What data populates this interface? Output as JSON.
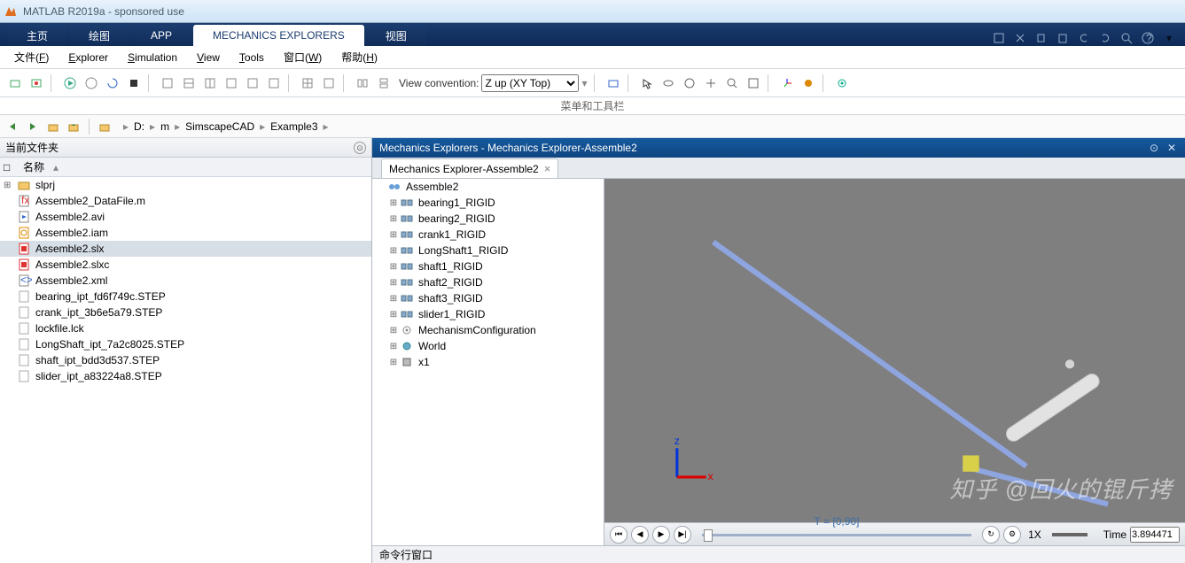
{
  "app": {
    "title": "MATLAB R2019a - sponsored use"
  },
  "ribbon_tabs": [
    {
      "label": "主页"
    },
    {
      "label": "绘图"
    },
    {
      "label": "APP"
    },
    {
      "label": "MECHANICS EXPLORERS",
      "active": true
    },
    {
      "label": "视图"
    }
  ],
  "menus": [
    {
      "label": "文件",
      "acc": "F"
    },
    {
      "label": "Explorer",
      "acc": "E"
    },
    {
      "label": "Simulation",
      "acc": "S"
    },
    {
      "label": "View",
      "acc": "V"
    },
    {
      "label": "Tools",
      "acc": "T"
    },
    {
      "label": "窗口",
      "acc": "W"
    },
    {
      "label": "帮助",
      "acc": "H"
    }
  ],
  "toolbar": {
    "view_convention_label": "View convention:",
    "view_convention_value": "Z up (XY Top)"
  },
  "hint": "菜单和工具栏",
  "breadcrumbs": [
    "D:",
    "m",
    "SimscapeCAD",
    "Example3",
    ""
  ],
  "current_folder": {
    "title": "当前文件夹",
    "col_name": "名称",
    "files": [
      {
        "name": "slprj",
        "icon": "folder",
        "expandable": true
      },
      {
        "name": "Assemble2_DataFile.m",
        "icon": "mfile"
      },
      {
        "name": "Assemble2.avi",
        "icon": "video"
      },
      {
        "name": "Assemble2.iam",
        "icon": "cad"
      },
      {
        "name": "Assemble2.slx",
        "icon": "simulink",
        "selected": true
      },
      {
        "name": "Assemble2.slxc",
        "icon": "simulink"
      },
      {
        "name": "Assemble2.xml",
        "icon": "xml"
      },
      {
        "name": "bearing_ipt_fd6f749c.STEP",
        "icon": "file"
      },
      {
        "name": "crank_ipt_3b6e5a79.STEP",
        "icon": "file"
      },
      {
        "name": "lockfile.lck",
        "icon": "file"
      },
      {
        "name": "LongShaft_ipt_7a2c8025.STEP",
        "icon": "file"
      },
      {
        "name": "shaft_ipt_bdd3d537.STEP",
        "icon": "file"
      },
      {
        "name": "slider_ipt_a83224a8.STEP",
        "icon": "file"
      }
    ]
  },
  "mechanics": {
    "panel_title": "Mechanics Explorers - Mechanics Explorer-Assemble2",
    "tab_label": "Mechanics Explorer-Assemble2",
    "tree_root": "Assemble2",
    "tree": [
      {
        "name": "bearing1_RIGID",
        "icon": "block"
      },
      {
        "name": "bearing2_RIGID",
        "icon": "block"
      },
      {
        "name": "crank1_RIGID",
        "icon": "block"
      },
      {
        "name": "LongShaft1_RIGID",
        "icon": "block"
      },
      {
        "name": "shaft1_RIGID",
        "icon": "block"
      },
      {
        "name": "shaft2_RIGID",
        "icon": "block"
      },
      {
        "name": "shaft3_RIGID",
        "icon": "block"
      },
      {
        "name": "slider1_RIGID",
        "icon": "block"
      },
      {
        "name": "MechanismConfiguration",
        "icon": "gear"
      },
      {
        "name": "World",
        "icon": "world"
      },
      {
        "name": "x1",
        "icon": "body"
      }
    ]
  },
  "playback": {
    "range_label": "T = [0,90]",
    "speed": "1X",
    "time_label": "Time",
    "time_value": "3.894471"
  },
  "cmd_title": "命令行窗口",
  "watermark": "知乎 @回火的锟斤拷"
}
